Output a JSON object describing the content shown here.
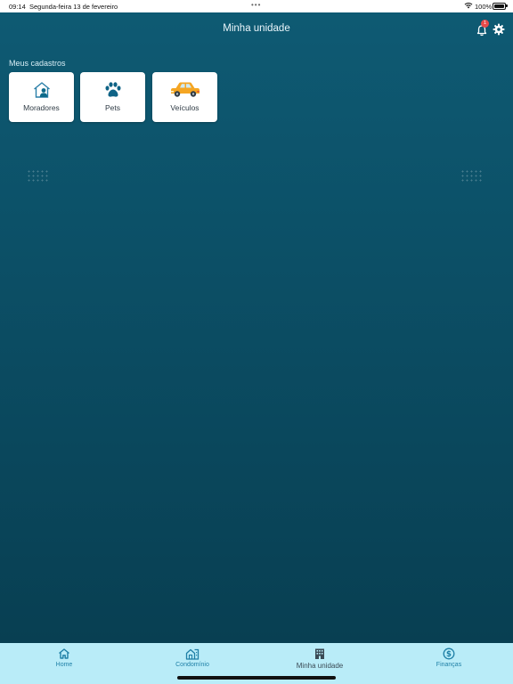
{
  "status_bar": {
    "time": "09:14",
    "date": "Segunda-feira 13 de fevereiro",
    "multitask_dots": "•••",
    "battery": "100%"
  },
  "header": {
    "title": "Minha unidade",
    "notification_count": "1"
  },
  "section": {
    "title": "Meus cadastros"
  },
  "cards": [
    {
      "label": "Moradores",
      "icon": "house-person-icon"
    },
    {
      "label": "Pets",
      "icon": "paw-icon"
    },
    {
      "label": "Veículos",
      "icon": "car-icon"
    }
  ],
  "bottom_nav": [
    {
      "label": "Home",
      "icon": "home-icon"
    },
    {
      "label": "Condomínio",
      "icon": "condo-icon"
    },
    {
      "label": "Minha unidade",
      "icon": "building-icon",
      "active": true
    },
    {
      "label": "Finanças",
      "icon": "dollar-icon"
    }
  ],
  "colors": {
    "background": "#0b4d63",
    "accent": "#1e7fa6",
    "bottom_bar": "#b9ecf8",
    "badge": "#e84a4a",
    "car": "#f5a623"
  }
}
